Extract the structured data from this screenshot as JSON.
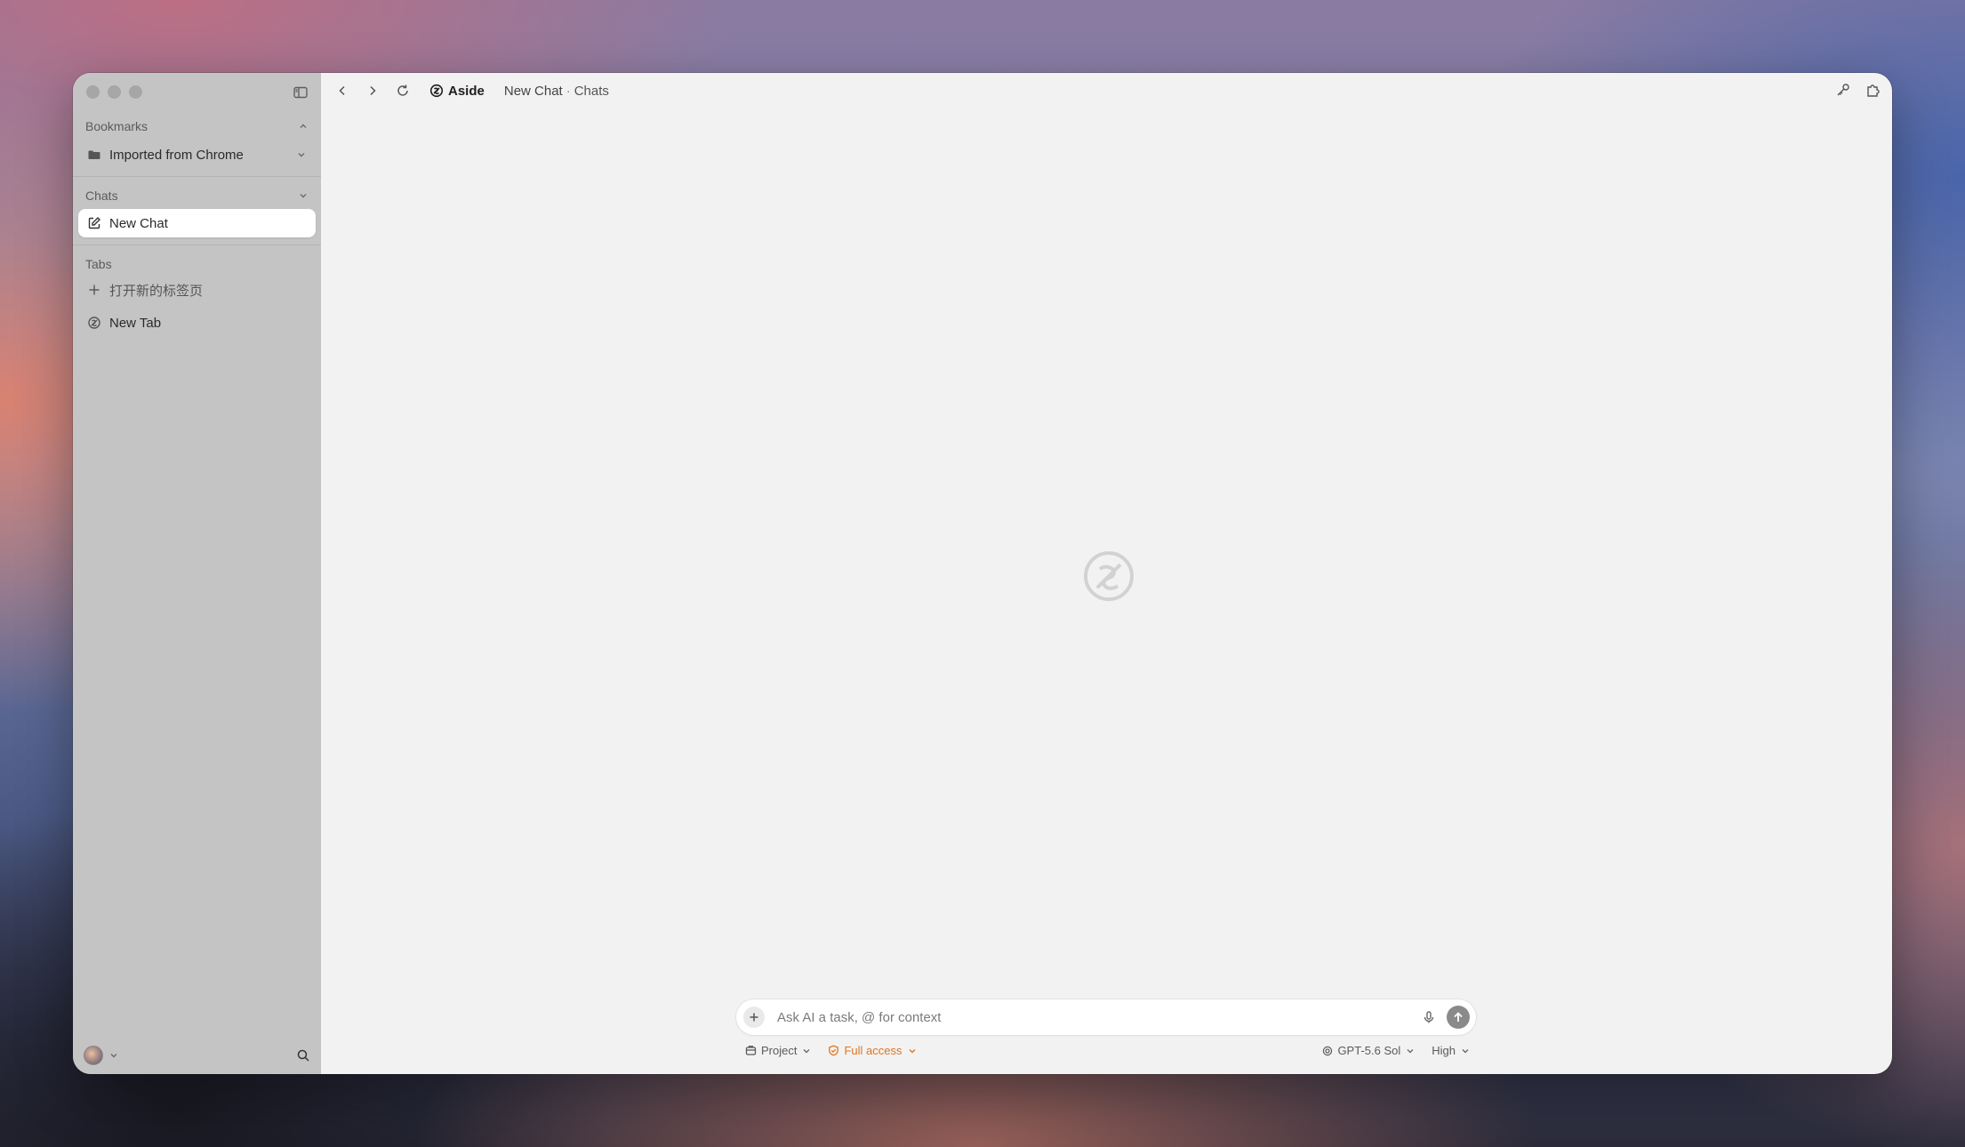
{
  "sidebar": {
    "bookmarks_header": "Bookmarks",
    "bookmark_folder": "Imported from Chrome",
    "chats_header": "Chats",
    "chat_item": "New Chat",
    "tabs_header": "Tabs",
    "open_new_tab": "打开新的标签页",
    "tab_item": "New Tab"
  },
  "toolbar": {
    "brand": "Aside",
    "crumb_title": "New Chat",
    "crumb_separator": "·",
    "crumb_section": "Chats"
  },
  "composer": {
    "placeholder": "Ask AI a task, @ for context",
    "project_label": "Project",
    "access_label": "Full access",
    "model_label": "GPT-5.6 Sol",
    "effort_label": "High"
  },
  "colors": {
    "accent_orange": "#e0751e",
    "sidebar_bg": "#c4c4c4",
    "main_bg": "#f2f2f2"
  }
}
